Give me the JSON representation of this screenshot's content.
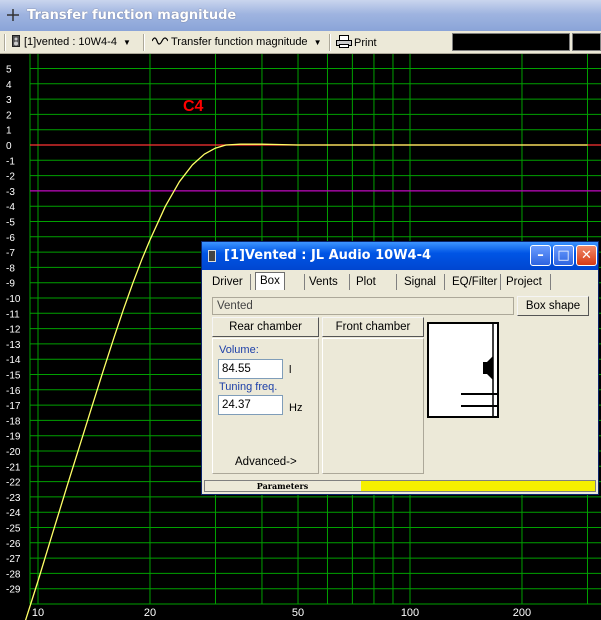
{
  "window": {
    "title": "Transfer function magnitude"
  },
  "toolbar": {
    "driver_select": "[1]vented : 10W4-4",
    "view_select": "Transfer function magnitude",
    "print_label": "Print"
  },
  "plot": {
    "annotation": "C4",
    "colors": {
      "grid": "#00a000",
      "curve": "#ffff66",
      "ref_0db": "#ff3333",
      "ref_3db": "#c000c0",
      "annotation": "#ff0000"
    },
    "y_ticks": [
      "5",
      "4",
      "3",
      "2",
      "1",
      "0",
      "-1",
      "-2",
      "-3",
      "-4",
      "-5",
      "-6",
      "-7",
      "-8",
      "-9",
      "-10",
      "-11",
      "-12",
      "-13",
      "-14",
      "-15",
      "-16",
      "-17",
      "-18",
      "-19",
      "-20",
      "-21",
      "-22",
      "-23",
      "-24",
      "-25",
      "-26",
      "-27",
      "-28",
      "-29"
    ],
    "x_ticks": [
      "10",
      "20",
      "50",
      "100",
      "200"
    ]
  },
  "chart_data": {
    "type": "line",
    "xscale": "log",
    "xlim": [
      10,
      300
    ],
    "ylim": [
      -30,
      5
    ],
    "grid": true,
    "annotations": [
      "C4"
    ],
    "reference_lines": [
      0,
      -3
    ],
    "series": [
      {
        "x": [
          9,
          10,
          11,
          12,
          13,
          14,
          15,
          16,
          17,
          18,
          19,
          20,
          22,
          24,
          26,
          28,
          30,
          32,
          35,
          40,
          50,
          70,
          100,
          200,
          300
        ],
        "y": [
          -32,
          -28.5,
          -25.2,
          -22.2,
          -19.5,
          -17.0,
          -14.7,
          -12.6,
          -10.7,
          -9.0,
          -7.5,
          -6.2,
          -4.0,
          -2.4,
          -1.3,
          -0.6,
          -0.2,
          0.0,
          0.05,
          0.05,
          0.0,
          0.0,
          0.0,
          0.0,
          0.0
        ]
      }
    ]
  },
  "dialog": {
    "title": "[1]Vented : JL Audio 10W4-4",
    "tabs": [
      "Driver",
      "Box",
      "Vents",
      "Plot",
      "Signal",
      "EQ/Filter",
      "Project"
    ],
    "active_tab": "Box",
    "box_type": "Vented",
    "box_shape_button": "Box shape",
    "rear_chamber_button": "Rear chamber",
    "front_chamber_button": "Front chamber",
    "volume_label": "Volume:",
    "volume_value": "84.55",
    "volume_unit": "l",
    "tuning_label": "Tuning freq.",
    "tuning_value": "24.37",
    "tuning_unit": "Hz",
    "advanced_label": "Advanced->",
    "status_text": "Parameters",
    "status_color": "#f5ef00"
  }
}
